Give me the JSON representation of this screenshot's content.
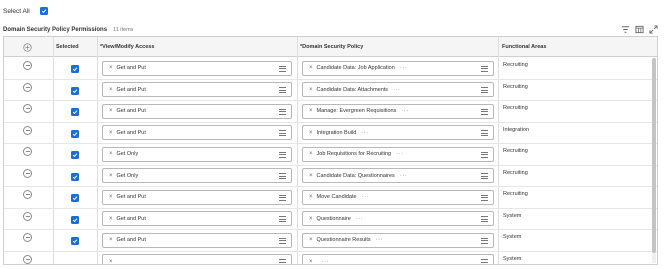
{
  "select_all": {
    "label": "Select All",
    "checked": true
  },
  "table": {
    "title": "Domain Security Policy Permissions",
    "count": "11 items",
    "headers": {
      "selected": "Selected",
      "view_modify": "*View/Modify Access",
      "policy": "*Domain Security Policy",
      "functional": "Functional Areas"
    },
    "rows": [
      {
        "access": "Get and Put",
        "policy": "Candidate Data: Job Application",
        "area": "Recruiting",
        "selected": true
      },
      {
        "access": "Get and Put",
        "policy": "Candidate Data: Attachments",
        "area": "Recruiting",
        "selected": true
      },
      {
        "access": "Get and Put",
        "policy": "Manage: Evergreen Requisitions",
        "area": "Recruiting",
        "selected": true
      },
      {
        "access": "Get and Put",
        "policy": "Integration Build",
        "area": "Integration",
        "selected": true
      },
      {
        "access": "Get Only",
        "policy": "Job Requisitions for Recruiting",
        "area": "Recruiting",
        "selected": true
      },
      {
        "access": "Get Only",
        "policy": "Candidate Data: Questionnaires",
        "area": "Recruiting",
        "selected": true
      },
      {
        "access": "Get and Put",
        "policy": "Move Candidate",
        "area": "Recruiting",
        "selected": true
      },
      {
        "access": "Get and Put",
        "policy": "Questionnaire",
        "area": "System",
        "selected": true
      },
      {
        "access": "Get and Put",
        "policy": "Questionnaire Results",
        "area": "System",
        "selected": true
      },
      {
        "access": "",
        "policy": "",
        "area": "System",
        "selected": false
      }
    ]
  },
  "icons": {
    "remove": "×",
    "more": "···",
    "prompt": "list-menu-icon",
    "filter": "filter-icon",
    "columns": "columns-icon",
    "expand": "expand-icon"
  },
  "colors": {
    "accent": "#1a6fd4"
  }
}
